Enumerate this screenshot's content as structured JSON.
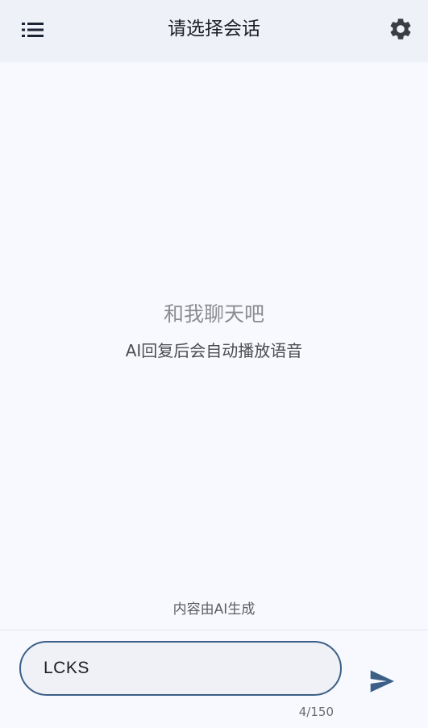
{
  "header": {
    "title": "请选择会话",
    "menu_icon": "list-menu-icon",
    "settings_icon": "gear-icon"
  },
  "empty_state": {
    "title": "和我聊天吧",
    "subtitle": "AI回复后会自动播放语音"
  },
  "footer_note": "内容由AI生成",
  "composer": {
    "input_value": "LCKS",
    "counter": "4/150",
    "send_icon": "send-icon"
  },
  "colors": {
    "accent": "#3b5f86",
    "header_bg": "#eef1f8",
    "page_bg": "#f7f9fe"
  }
}
